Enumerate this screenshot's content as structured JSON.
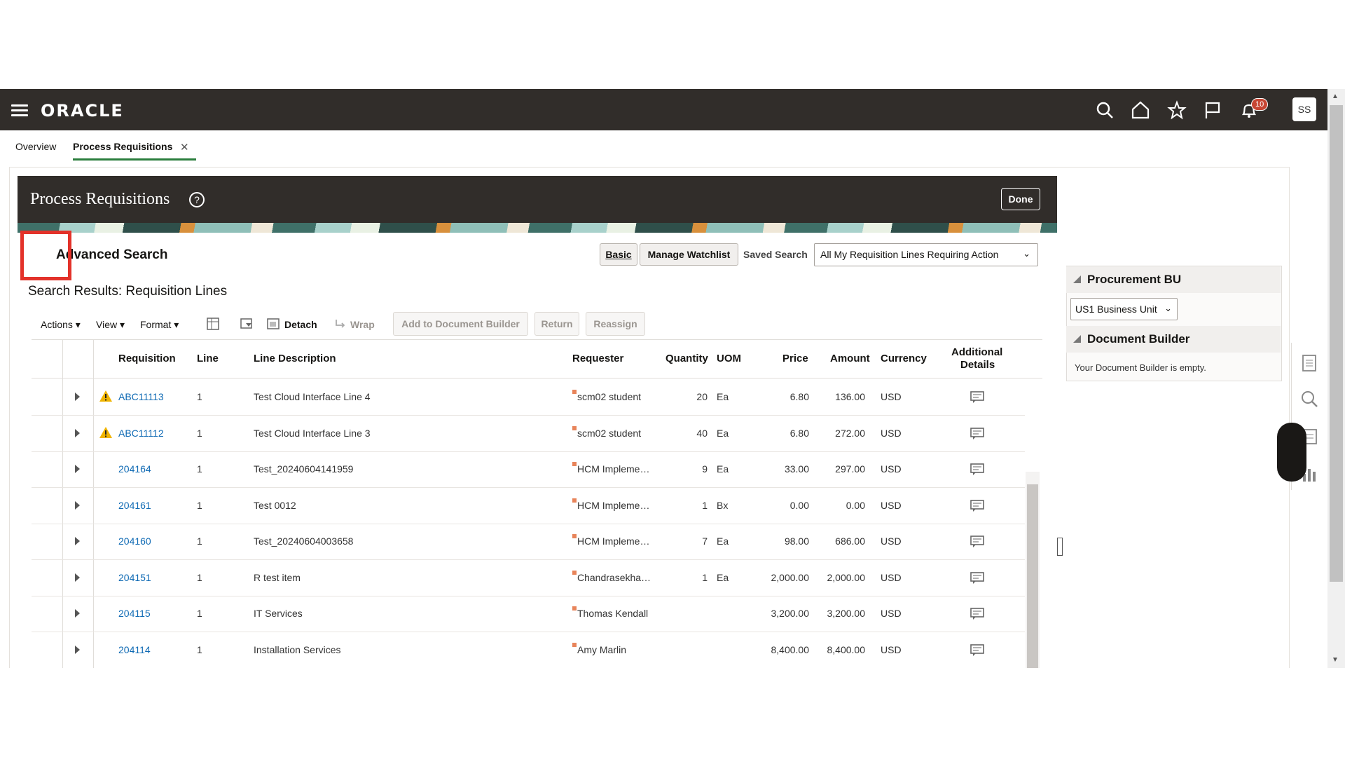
{
  "topbar": {
    "logo": "ORACLE",
    "notification_count": "10",
    "avatar_initials": "SS"
  },
  "tabs": [
    {
      "label": "Overview"
    },
    {
      "label": "Process Requisitions"
    }
  ],
  "page": {
    "title": "Process Requisitions",
    "help_glyph": "?",
    "done_label": "Done"
  },
  "search": {
    "heading": "Advanced Search",
    "basic_label": "Basic",
    "watchlist_label": "Manage Watchlist",
    "saved_search_label": "Saved Search",
    "saved_search_value": "All My Requisition Lines Requiring Action"
  },
  "results": {
    "title": "Search Results: Requisition Lines",
    "toolbar": {
      "actions": "Actions",
      "view": "View",
      "format": "Format",
      "detach": "Detach",
      "wrap": "Wrap",
      "add_to_doc_builder": "Add to Document Builder",
      "return": "Return",
      "reassign": "Reassign"
    },
    "columns": {
      "requisition": "Requisition",
      "line": "Line",
      "line_description": "Line Description",
      "requester": "Requester",
      "quantity": "Quantity",
      "uom": "UOM",
      "price": "Price",
      "amount": "Amount",
      "currency": "Currency",
      "additional_details_1": "Additional",
      "additional_details_2": "Details"
    },
    "rows": [
      {
        "requisition": "ABC11113",
        "warning": true,
        "line": "1",
        "description": "Test Cloud Interface Line 4",
        "requester": "scm02 student",
        "quantity": "20",
        "uom": "Ea",
        "price": "6.80",
        "amount": "136.00",
        "currency": "USD"
      },
      {
        "requisition": "ABC11112",
        "warning": true,
        "line": "1",
        "description": "Test Cloud Interface Line 3",
        "requester": "scm02 student",
        "quantity": "40",
        "uom": "Ea",
        "price": "6.80",
        "amount": "272.00",
        "currency": "USD"
      },
      {
        "requisition": "204164",
        "warning": false,
        "line": "1",
        "description": "Test_20240604141959",
        "requester": "HCM Impleme…",
        "quantity": "9",
        "uom": "Ea",
        "price": "33.00",
        "amount": "297.00",
        "currency": "USD"
      },
      {
        "requisition": "204161",
        "warning": false,
        "line": "1",
        "description": "Test 0012",
        "requester": "HCM Impleme…",
        "quantity": "1",
        "uom": "Bx",
        "price": "0.00",
        "amount": "0.00",
        "currency": "USD"
      },
      {
        "requisition": "204160",
        "warning": false,
        "line": "1",
        "description": "Test_20240604003658",
        "requester": "HCM Impleme…",
        "quantity": "7",
        "uom": "Ea",
        "price": "98.00",
        "amount": "686.00",
        "currency": "USD"
      },
      {
        "requisition": "204151",
        "warning": false,
        "line": "1",
        "description": "R test item",
        "requester": "Chandrasekha…",
        "quantity": "1",
        "uom": "Ea",
        "price": "2,000.00",
        "amount": "2,000.00",
        "currency": "USD"
      },
      {
        "requisition": "204115",
        "warning": false,
        "line": "1",
        "description": "IT Services",
        "requester": "Thomas Kendall",
        "quantity": "",
        "uom": "",
        "price": "3,200.00",
        "amount": "3,200.00",
        "currency": "USD"
      },
      {
        "requisition": "204114",
        "warning": false,
        "line": "1",
        "description": "Installation Services",
        "requester": "Amy Marlin",
        "quantity": "",
        "uom": "",
        "price": "8,400.00",
        "amount": "8,400.00",
        "currency": "USD"
      }
    ]
  },
  "right_panel": {
    "procurement_bu_title": "Procurement BU",
    "procurement_bu_value": "US1 Business Unit",
    "doc_builder_title": "Document Builder",
    "doc_builder_text": "Your Document Builder is empty."
  },
  "colors": {
    "header_bg": "#312d2a",
    "link": "#0f6ab4",
    "accent_tab": "#2a7d3c",
    "highlight_box": "#e3322a"
  }
}
